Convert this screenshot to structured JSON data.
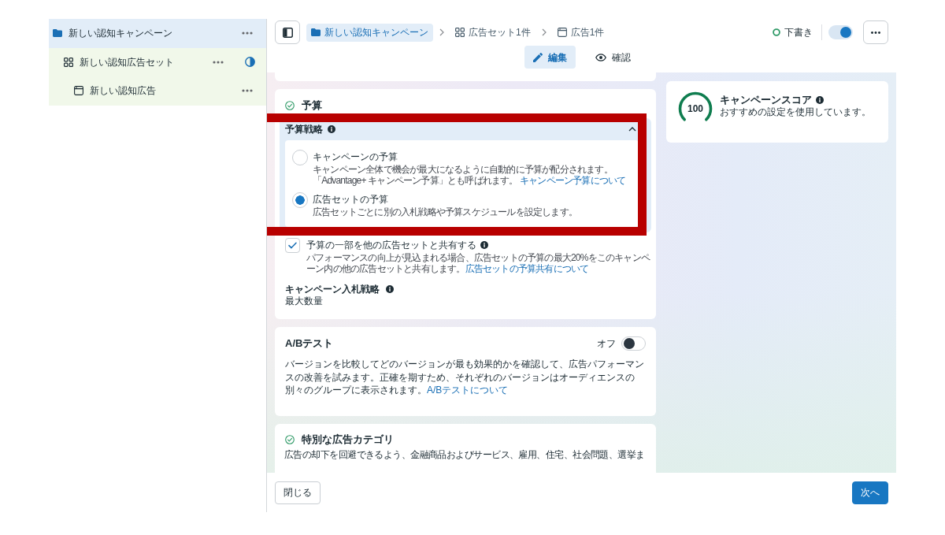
{
  "sidebar": {
    "items": [
      {
        "kind": "campaign",
        "label": "新しい認知キャンペーン",
        "selected": true,
        "children": [
          {
            "kind": "ad_set",
            "label": "新しい認知広告セット",
            "selected": false,
            "children": [
              {
                "kind": "ad",
                "label": "新しい認知広告",
                "selected": false
              }
            ]
          }
        ]
      }
    ]
  },
  "breadcrumb": [
    {
      "kind": "campaign",
      "label": "新しい認知キャンペーン",
      "selected": true
    },
    {
      "kind": "ad_set",
      "label": "広告セット1件",
      "selected": false
    },
    {
      "kind": "ad",
      "label": "広告1件",
      "selected": false
    }
  ],
  "status": {
    "label": "下書き"
  },
  "publish_toggle": {
    "on": true
  },
  "tabs": [
    {
      "kind": "edit",
      "label": "編集",
      "selected": true
    },
    {
      "kind": "review",
      "label": "確認",
      "selected": false
    }
  ],
  "budget": {
    "title": "予算",
    "strategy": {
      "title": "予算戦略",
      "expanded": true,
      "options": [
        {
          "label": "キャンペーンの予算",
          "description": "キャンペーン全体で機会が最大になるように自動的に予算が配分されます。「Advantage+ キャンペーン予算」とも呼ばれます。",
          "link": "キャンペーン予算について",
          "selected": false
        },
        {
          "label": "広告セットの予算",
          "description": "広告セットごとに別の入札戦略や予算スケジュールを設定します。",
          "selected": true
        }
      ]
    },
    "share_budget": {
      "label": "予算の一部を他の広告セットと共有する",
      "description": "パフォーマンスの向上が見込まれる場合、広告セットの予算の最大20%をこのキャンペーン内の他の広告セットと共有します。",
      "link": "広告セットの予算共有について",
      "checked": true
    },
    "bid_strategy": {
      "label": "キャンペーン入札戦略",
      "value": "最大数量"
    }
  },
  "ab_test": {
    "title": "A/Bテスト",
    "state_label": "オフ",
    "on": false,
    "description": "バージョンを比較してどのバージョンが最も効果的かを確認して、広告パフォーマンスの改善を試みます。正確を期すため、それぞれのバージョンはオーディエンスの別々のグループに表示されます。",
    "link": "A/Bテストについて"
  },
  "special_ad_category": {
    "title": "特別な広告カテゴリ",
    "description": "広告の却下を回避できるよう、金融商品およびサービス、雇用、住宅、社会問題、選挙ま"
  },
  "campaign_score": {
    "score": "100",
    "title": "キャンペーンスコア",
    "description": "おすすめの設定を使用しています。"
  },
  "footer": {
    "close": "閉じる",
    "next": "次へ"
  }
}
